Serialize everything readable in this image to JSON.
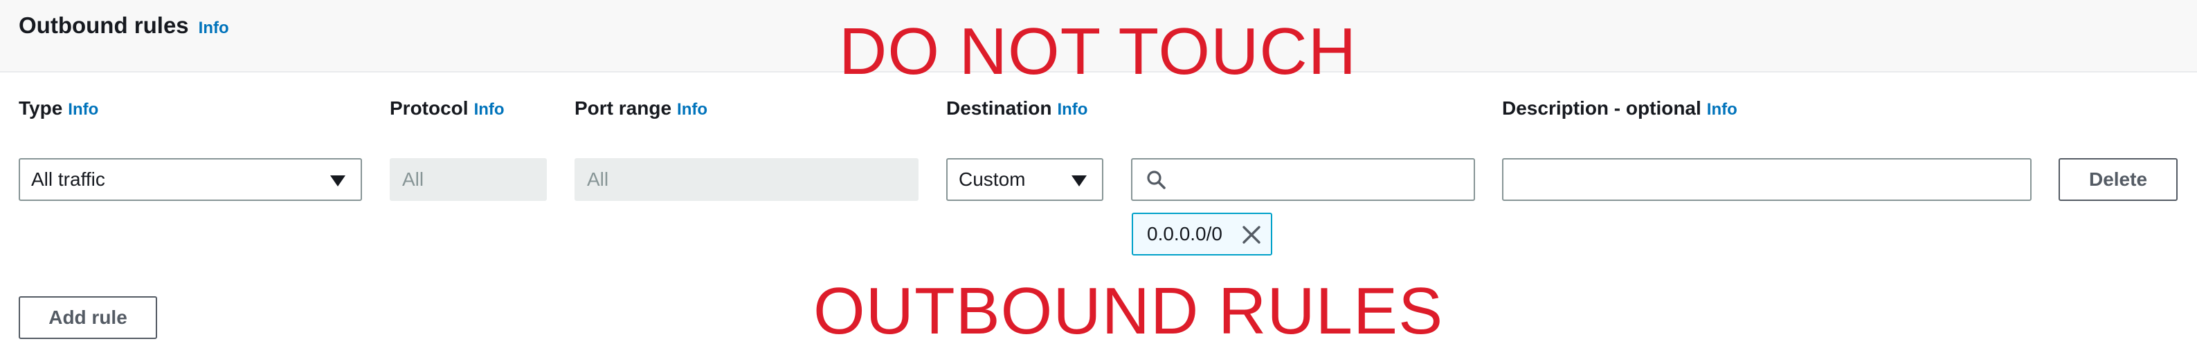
{
  "section": {
    "title": "Outbound rules",
    "info": "Info"
  },
  "columns": {
    "type": {
      "label": "Type",
      "info": "Info"
    },
    "protocol": {
      "label": "Protocol",
      "info": "Info"
    },
    "port_range": {
      "label": "Port range",
      "info": "Info"
    },
    "destination": {
      "label": "Destination",
      "info": "Info"
    },
    "description": {
      "label": "Description - optional",
      "info": "Info"
    }
  },
  "rule": {
    "type_value": "All traffic",
    "protocol_value": "All",
    "port_range_value": "All",
    "destination_mode": "Custom",
    "destination_search_value": "",
    "destination_token": "0.0.0.0/0",
    "description_value": "",
    "delete_label": "Delete"
  },
  "actions": {
    "add_rule_label": "Add rule"
  },
  "overlays": {
    "top": "DO NOT TOUCH",
    "bottom": "OUTBOUND RULES"
  },
  "colors": {
    "info_link": "#0073bb",
    "overlay_text": "#dd1c2a",
    "token_border": "#00a1c9",
    "token_background": "#f1faff",
    "disabled_field": "#eaeded"
  },
  "icons": {
    "type_dropdown": "caret-down-icon",
    "destination_dropdown": "caret-down-icon",
    "destination_search": "search-icon",
    "token_remove": "close-icon"
  }
}
